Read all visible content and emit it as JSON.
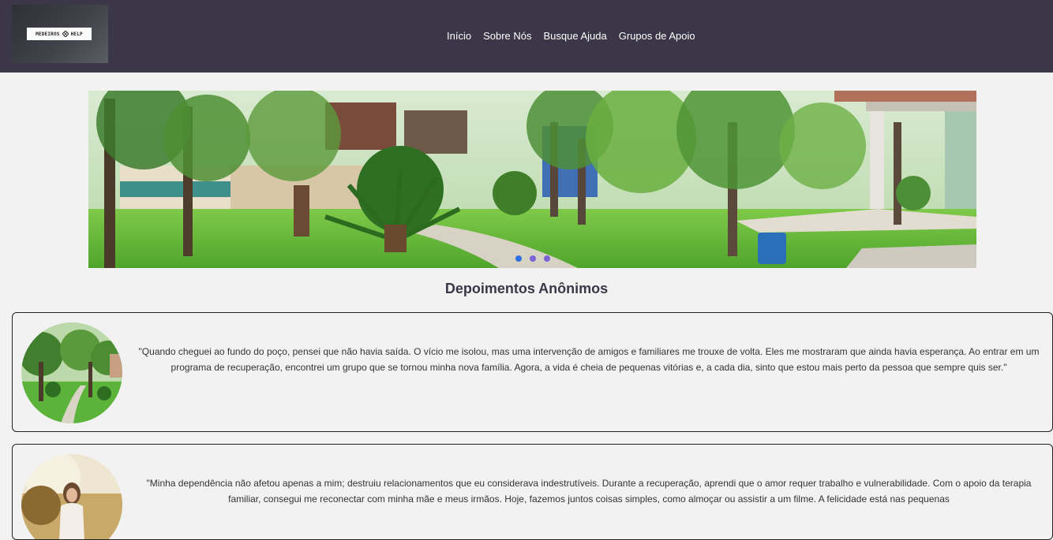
{
  "header": {
    "logo": {
      "text_left": "MEDEIROS",
      "text_right": "HELP",
      "icon": "diamond-lattice-icon"
    },
    "nav": [
      {
        "label": "Início"
      },
      {
        "label": "Sobre Nós"
      },
      {
        "label": "Busque Ajuda"
      },
      {
        "label": "Grupos de Apoio"
      }
    ]
  },
  "carousel": {
    "slide_count": 3,
    "active_index": 0,
    "colors": {
      "active_dot": "#2f6fe6",
      "inactive_dot": "#7a64d8"
    }
  },
  "testimonials": {
    "title": "Depoimentos Anônimos",
    "items": [
      {
        "quote": "\"Quando cheguei ao fundo do poço, pensei que não havia saída. O vício me isolou, mas uma intervenção de amigos e familiares me trouxe de volta. Eles me mostraram que ainda havia esperança. Ao entrar em um programa de recuperação, encontrei um grupo que se tornou minha nova família. Agora, a vida é cheia de pequenas vitórias e, a cada dia, sinto que estou mais perto da pessoa que sempre quis ser.\""
      },
      {
        "quote": "\"Minha dependência não afetou apenas a mim; destruiu relacionamentos que eu considerava indestrutíveis. Durante a recuperação, aprendi que o amor requer trabalho e vulnerabilidade. Com o apoio da terapia familiar, consegui me reconectar com minha mãe e meus irmãos. Hoje, fazemos juntos coisas simples, como almoçar ou assistir a um filme. A felicidade está nas pequenas"
      }
    ]
  },
  "theme": {
    "header_bg": "#3b3748",
    "page_bg": "#f2f2f2",
    "heading_color": "#3b3748"
  }
}
